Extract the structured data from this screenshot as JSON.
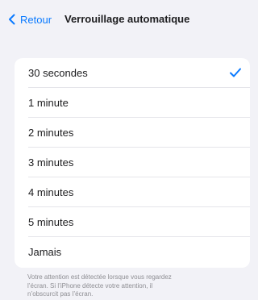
{
  "nav": {
    "back_label": "Retour",
    "title": "Verrouillage automatique"
  },
  "options": [
    {
      "label": "30 secondes",
      "selected": true
    },
    {
      "label": "1 minute",
      "selected": false
    },
    {
      "label": "2 minutes",
      "selected": false
    },
    {
      "label": "3 minutes",
      "selected": false
    },
    {
      "label": "4 minutes",
      "selected": false
    },
    {
      "label": "5 minutes",
      "selected": false
    },
    {
      "label": "Jamais",
      "selected": false
    }
  ],
  "footer": {
    "line1": "Votre attention est détectée lorsque vous regardez",
    "line2": "l’écran. Si l’iPhone détecte votre attention, il",
    "line3": "n’obscurcit pas l’écran."
  },
  "colors": {
    "accent": "#0a7aff",
    "background": "#f2f2f7",
    "cell": "#ffffff",
    "separator": "#e5e5ea",
    "footer_text": "#8e8e93"
  },
  "icons": {
    "back": "chevron-left-icon",
    "selected": "checkmark-icon"
  }
}
